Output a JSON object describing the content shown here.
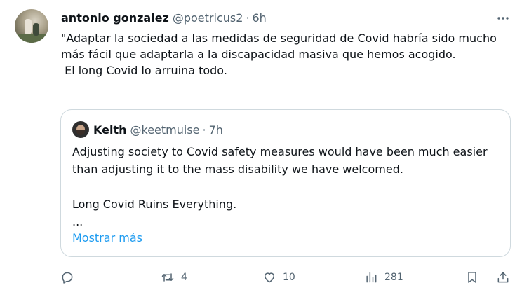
{
  "tweet": {
    "author_name": "antonio gonzalez",
    "handle": "@poetricus2",
    "separator": "·",
    "time": "6h",
    "text": "\"Adaptar la sociedad a las medidas de seguridad de Covid habría sido mucho más fácil que adaptarla a la discapacidad masiva que hemos acogido.\n El long Covid lo arruina todo.",
    "more_icon": "more-horizontal-icon"
  },
  "quote": {
    "author_name": "Keith",
    "handle": "@keetmuise",
    "separator": "·",
    "time": "7h",
    "text": "Adjusting society to Covid safety measures would have been much easier than adjusting it to the mass disability we have welcomed.\n\nLong Covid Ruins Everything.\n...",
    "show_more": "Mostrar más"
  },
  "actions": {
    "reply_icon": "reply-icon",
    "retweet_icon": "retweet-icon",
    "retweet_count": "4",
    "like_icon": "heart-icon",
    "like_count": "10",
    "views_icon": "views-icon",
    "views_count": "281",
    "bookmark_icon": "bookmark-icon",
    "share_icon": "share-icon"
  },
  "colors": {
    "text": "#0f1419",
    "muted": "#536471",
    "link": "#1d9bf0",
    "border": "#cfd9de"
  }
}
